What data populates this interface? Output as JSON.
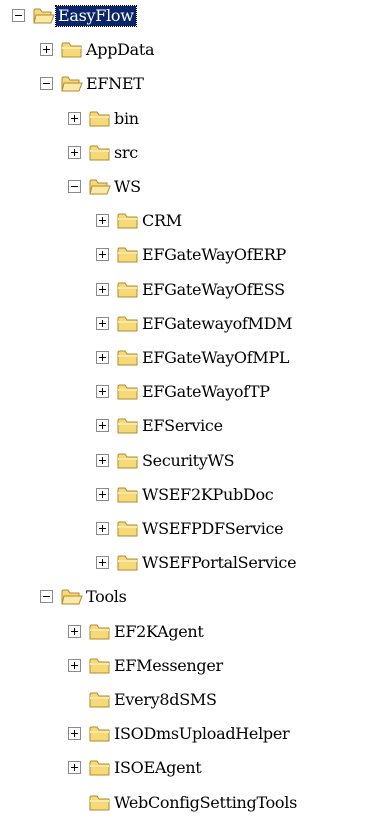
{
  "tree": {
    "nodes": [
      {
        "label": "EasyFlow",
        "level": 0,
        "toggle": "minus",
        "open": true,
        "selected": true
      },
      {
        "label": "AppData",
        "level": 1,
        "toggle": "plus",
        "open": false,
        "selected": false
      },
      {
        "label": "EFNET",
        "level": 1,
        "toggle": "minus",
        "open": true,
        "selected": false
      },
      {
        "label": "bin",
        "level": 2,
        "toggle": "plus",
        "open": false,
        "selected": false
      },
      {
        "label": "src",
        "level": 2,
        "toggle": "plus",
        "open": false,
        "selected": false
      },
      {
        "label": "WS",
        "level": 2,
        "toggle": "minus",
        "open": true,
        "selected": false
      },
      {
        "label": "CRM",
        "level": 3,
        "toggle": "plus",
        "open": false,
        "selected": false
      },
      {
        "label": "EFGateWayOfERP",
        "level": 3,
        "toggle": "plus",
        "open": false,
        "selected": false
      },
      {
        "label": "EFGateWayOfESS",
        "level": 3,
        "toggle": "plus",
        "open": false,
        "selected": false
      },
      {
        "label": "EFGatewayofMDM",
        "level": 3,
        "toggle": "plus",
        "open": false,
        "selected": false
      },
      {
        "label": "EFGateWayOfMPL",
        "level": 3,
        "toggle": "plus",
        "open": false,
        "selected": false
      },
      {
        "label": "EFGateWayofTP",
        "level": 3,
        "toggle": "plus",
        "open": false,
        "selected": false
      },
      {
        "label": "EFService",
        "level": 3,
        "toggle": "plus",
        "open": false,
        "selected": false
      },
      {
        "label": "SecurityWS",
        "level": 3,
        "toggle": "plus",
        "open": false,
        "selected": false
      },
      {
        "label": "WSEF2KPubDoc",
        "level": 3,
        "toggle": "plus",
        "open": false,
        "selected": false
      },
      {
        "label": "WSEFPDFService",
        "level": 3,
        "toggle": "plus",
        "open": false,
        "selected": false
      },
      {
        "label": "WSEFPortalService",
        "level": 3,
        "toggle": "plus",
        "open": false,
        "selected": false
      },
      {
        "label": "Tools",
        "level": 1,
        "toggle": "minus",
        "open": true,
        "selected": false
      },
      {
        "label": "EF2KAgent",
        "level": 2,
        "toggle": "plus",
        "open": false,
        "selected": false
      },
      {
        "label": "EFMessenger",
        "level": 2,
        "toggle": "plus",
        "open": false,
        "selected": false
      },
      {
        "label": "Every8dSMS",
        "level": 2,
        "toggle": "none",
        "open": false,
        "selected": false
      },
      {
        "label": "ISODmsUploadHelper",
        "level": 2,
        "toggle": "plus",
        "open": false,
        "selected": false
      },
      {
        "label": "ISOEAgent",
        "level": 2,
        "toggle": "plus",
        "open": false,
        "selected": false
      },
      {
        "label": "WebConfigSettingTools",
        "level": 2,
        "toggle": "none",
        "open": false,
        "selected": false
      }
    ],
    "colors": {
      "folder_fill": "#f6d978",
      "folder_tab": "#fbe9a7",
      "folder_stroke": "#b08a2c",
      "selection_bg": "#0a246a"
    }
  }
}
